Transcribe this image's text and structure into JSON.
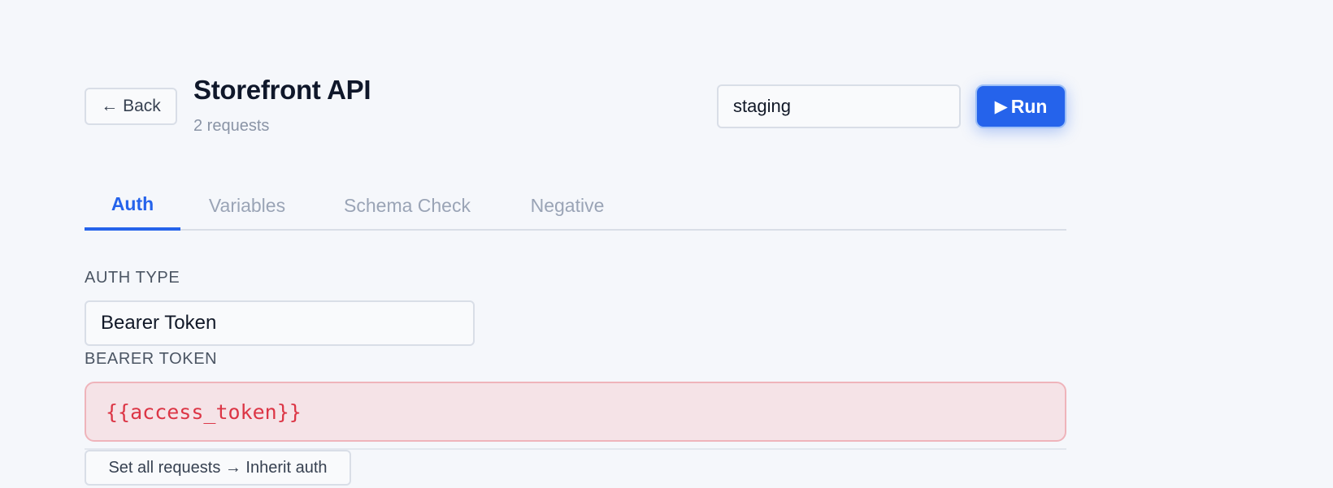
{
  "header": {
    "back_label": "← Back",
    "title": "Storefront API",
    "subtitle": "2 requests",
    "environment_value": "staging",
    "run_icon": "▶",
    "run_label": "Run"
  },
  "tabs": [
    {
      "label": "Auth",
      "active": true
    },
    {
      "label": "Variables",
      "active": false
    },
    {
      "label": "Schema Check",
      "active": false
    },
    {
      "label": "Negative",
      "active": false
    }
  ],
  "auth": {
    "type_label": "AUTH TYPE",
    "type_value": "Bearer Token",
    "token_label": "BEARER TOKEN",
    "token_value": "{{access_token}}",
    "inherit_button_label": "Set all requests → Inherit auth"
  },
  "colors": {
    "accent": "#2563eb",
    "error_text": "#dc3545",
    "error_bg": "#f5e3e7",
    "background": "#f5f7fb"
  }
}
